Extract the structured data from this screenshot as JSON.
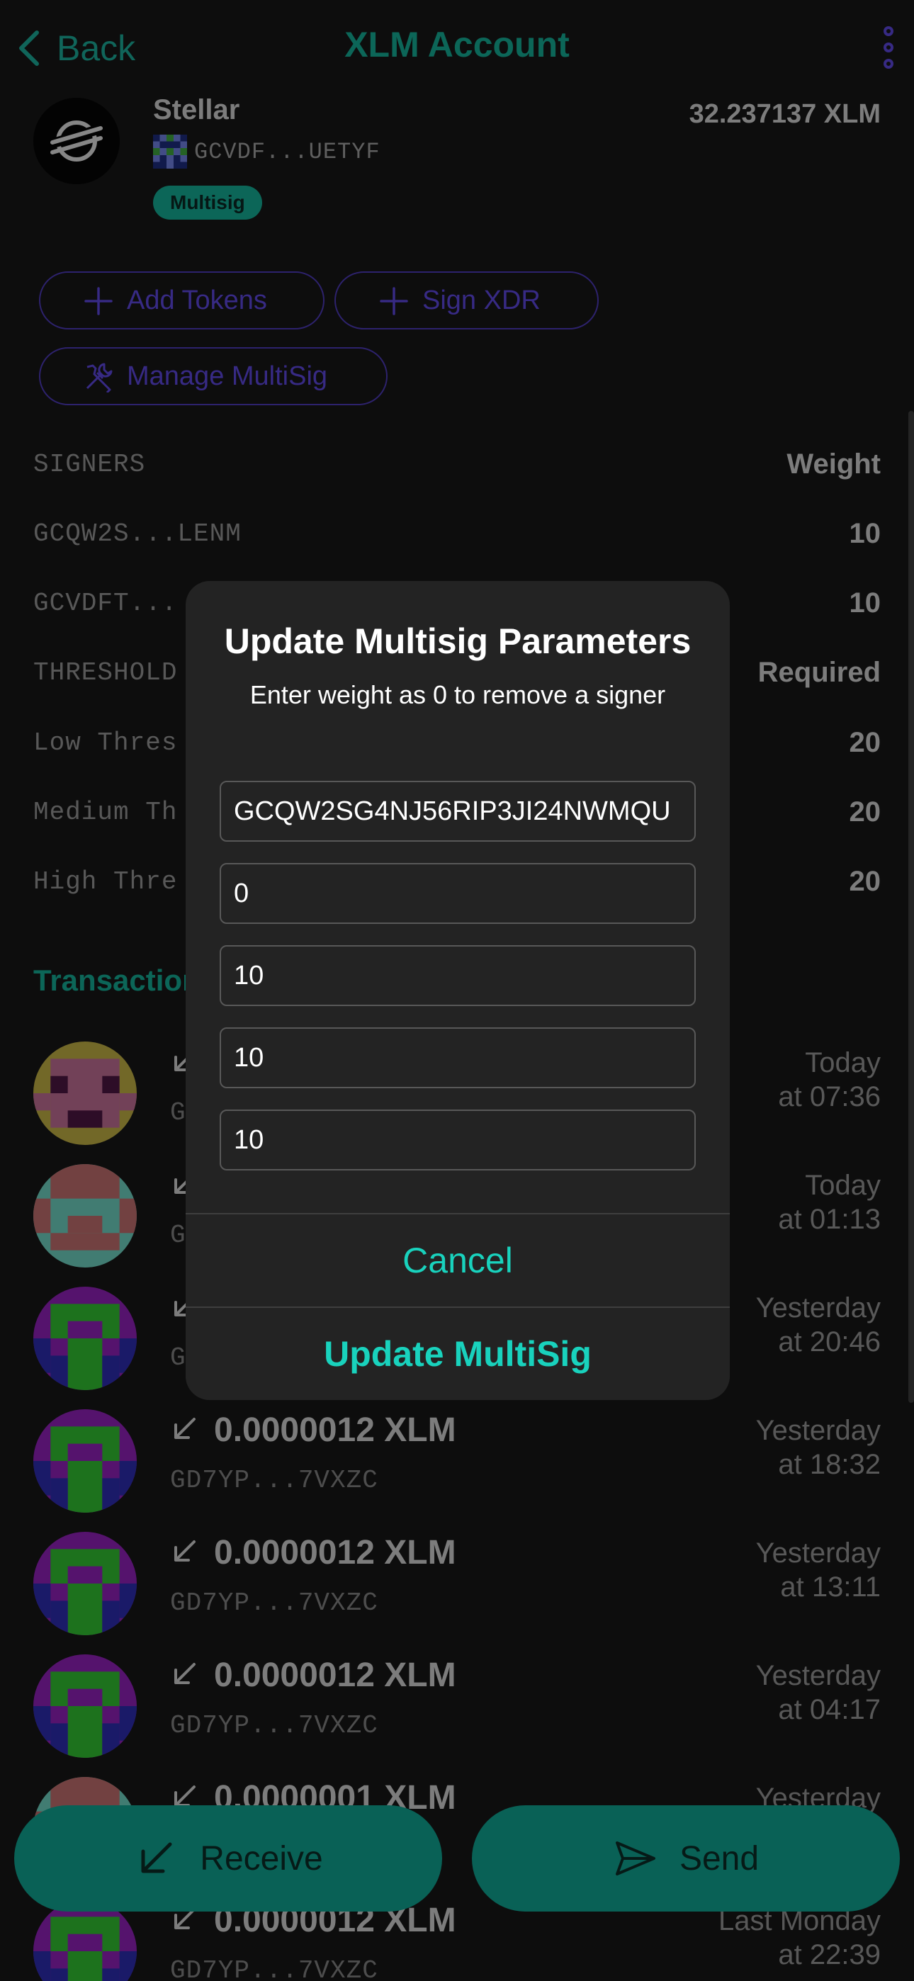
{
  "header": {
    "back_label": "Back",
    "title": "XLM Account"
  },
  "account": {
    "name": "Stellar",
    "address": "GCVDF...UETYF",
    "badge": "Multisig",
    "balance": "32.237137 XLM"
  },
  "actions": {
    "add_tokens": "Add Tokens",
    "sign_xdr": "Sign XDR",
    "manage_multisig": "Manage MultiSig"
  },
  "signers": {
    "header_key": "SIGNERS",
    "header_value": "Weight",
    "rows": [
      {
        "key": "GCQW2S...LENM",
        "value": "10"
      },
      {
        "key": "GCVDFT...",
        "value": "10"
      }
    ]
  },
  "thresholds": {
    "header_key": "THRESHOLD",
    "header_value": "Required",
    "rows": [
      {
        "key": "Low Thres",
        "value": "20"
      },
      {
        "key": "Medium Th",
        "value": "20"
      },
      {
        "key": "High Thre",
        "value": "20"
      }
    ]
  },
  "transactions": {
    "heading": "Transaction",
    "items": [
      {
        "amount": "",
        "address": "G",
        "date_line1": "Today",
        "date_line2": "at 07:36",
        "avatar": "yellow-pink-identicon"
      },
      {
        "amount": "",
        "address": "G",
        "date_line1": "Today",
        "date_line2": "at 01:13",
        "avatar": "teal-pink-identicon"
      },
      {
        "amount": "",
        "address": "G",
        "date_line1": "Yesterday",
        "date_line2": "at 20:46",
        "avatar": "green-purple-identicon"
      },
      {
        "amount": "0.0000012 XLM",
        "address": "GD7YP...7VXZC",
        "date_line1": "Yesterday",
        "date_line2": "at 18:32",
        "avatar": "green-purple-identicon"
      },
      {
        "amount": "0.0000012 XLM",
        "address": "GD7YP...7VXZC",
        "date_line1": "Yesterday",
        "date_line2": "at 13:11",
        "avatar": "green-purple-identicon"
      },
      {
        "amount": "0.0000012 XLM",
        "address": "GD7YP...7VXZC",
        "date_line1": "Yesterday",
        "date_line2": "at 04:17",
        "avatar": "green-purple-identicon"
      },
      {
        "amount": "0.0000001 XLM",
        "address": "",
        "date_line1": "Yesterday",
        "date_line2": "",
        "avatar": "teal-pink-identicon"
      },
      {
        "amount": "0.0000012 XLM",
        "address": "GD7YP...7VXZC",
        "date_line1": "Last Monday",
        "date_line2": "at 22:39",
        "avatar": "green-purple-identicon"
      }
    ]
  },
  "modal": {
    "title": "Update Multisig Parameters",
    "subtitle": "Enter weight as 0 to remove a signer",
    "fields": [
      "GCQW2SG4NJ56RIP3JI24NWMQU",
      "0",
      "10",
      "10",
      "10"
    ],
    "cancel_label": "Cancel",
    "submit_label": "Update MultiSig"
  },
  "bottom_bar": {
    "receive_label": "Receive",
    "send_label": "Send"
  },
  "colors": {
    "accent": "#14a58f",
    "accent_bright": "#19d2bd",
    "purple": "#5a44d6",
    "background": "#151515",
    "modal": "#232323"
  }
}
